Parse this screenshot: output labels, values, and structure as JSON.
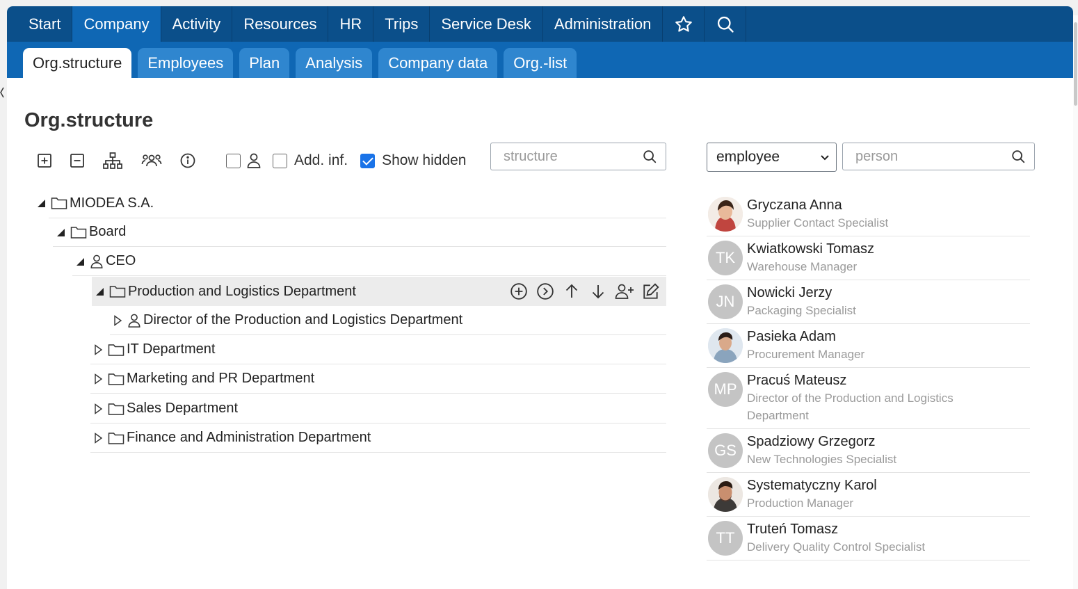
{
  "nav": {
    "items": [
      {
        "label": "Start",
        "active": false
      },
      {
        "label": "Company",
        "active": true
      },
      {
        "label": "Activity",
        "active": false
      },
      {
        "label": "Resources",
        "active": false
      },
      {
        "label": "HR",
        "active": false
      },
      {
        "label": "Trips",
        "active": false
      },
      {
        "label": "Service Desk",
        "active": false
      },
      {
        "label": "Administration",
        "active": false
      }
    ],
    "icons": [
      "star-icon",
      "search-icon"
    ]
  },
  "subnav": {
    "tabs": [
      {
        "label": "Org.structure",
        "active": true
      },
      {
        "label": "Employees",
        "active": false
      },
      {
        "label": "Plan",
        "active": false
      },
      {
        "label": "Analysis",
        "active": false
      },
      {
        "label": "Company data",
        "active": false
      },
      {
        "label": "Org.-list",
        "active": false
      }
    ]
  },
  "page": {
    "title": "Org.structure"
  },
  "toolbar": {
    "icons": [
      "expand-all-icon",
      "collapse-all-icon",
      "org-chart-icon",
      "group-icon",
      "info-icon"
    ],
    "checkboxes": [
      {
        "label": "",
        "icon": "person-icon",
        "checked": false
      },
      {
        "label": "Add. inf.",
        "checked": false
      },
      {
        "label": "Show hidden",
        "checked": true
      }
    ],
    "structure_search": {
      "value": "",
      "placeholder": "structure"
    }
  },
  "filter": {
    "selected": "employee",
    "person_search": {
      "value": "",
      "placeholder": "person"
    }
  },
  "tree": [
    {
      "label": "MIODEA S.A.",
      "type": "folder",
      "expanded": true
    },
    {
      "label": "Board",
      "type": "folder",
      "expanded": true
    },
    {
      "label": "CEO",
      "type": "person",
      "expanded": true
    },
    {
      "label": "Production and Logistics Department",
      "type": "folder",
      "expanded": true,
      "selected": true
    },
    {
      "label": "Director of the Production and Logistics Department",
      "type": "person",
      "expanded": false
    },
    {
      "label": "IT Department",
      "type": "folder",
      "expanded": false
    },
    {
      "label": "Marketing and PR Department",
      "type": "folder",
      "expanded": false
    },
    {
      "label": "Sales Department",
      "type": "folder",
      "expanded": false
    },
    {
      "label": "Finance and Administration Department",
      "type": "folder",
      "expanded": false
    }
  ],
  "row_actions": [
    "add-circle-icon",
    "go-circle-icon",
    "arrow-up-icon",
    "arrow-down-icon",
    "add-person-icon",
    "edit-icon"
  ],
  "employees": [
    {
      "name": "Gryczana Anna",
      "role": "Supplier Contact Specialist",
      "initials": "",
      "photo": "woman"
    },
    {
      "name": "Kwiatkowski Tomasz",
      "role": "Warehouse Manager",
      "initials": "TK"
    },
    {
      "name": "Nowicki Jerzy",
      "role": "Packaging Specialist",
      "initials": "JN"
    },
    {
      "name": "Pasieka Adam",
      "role": "Procurement Manager",
      "initials": "",
      "photo": "man1"
    },
    {
      "name": "Pracuś Mateusz",
      "role": "Director of the Production and Logistics Department",
      "initials": "MP"
    },
    {
      "name": "Spadziowy Grzegorz",
      "role": "New Technologies Specialist",
      "initials": "GS"
    },
    {
      "name": "Systematyczny Karol",
      "role": "Production Manager",
      "initials": "",
      "photo": "man2"
    },
    {
      "name": "Truteń Tomasz",
      "role": "Delivery Quality Control Specialist",
      "initials": "TT"
    }
  ],
  "colors": {
    "nav": "#0b4f8a",
    "subnav": "#0f67b4",
    "tab": "#2f86cf",
    "check": "#1a73e8"
  }
}
